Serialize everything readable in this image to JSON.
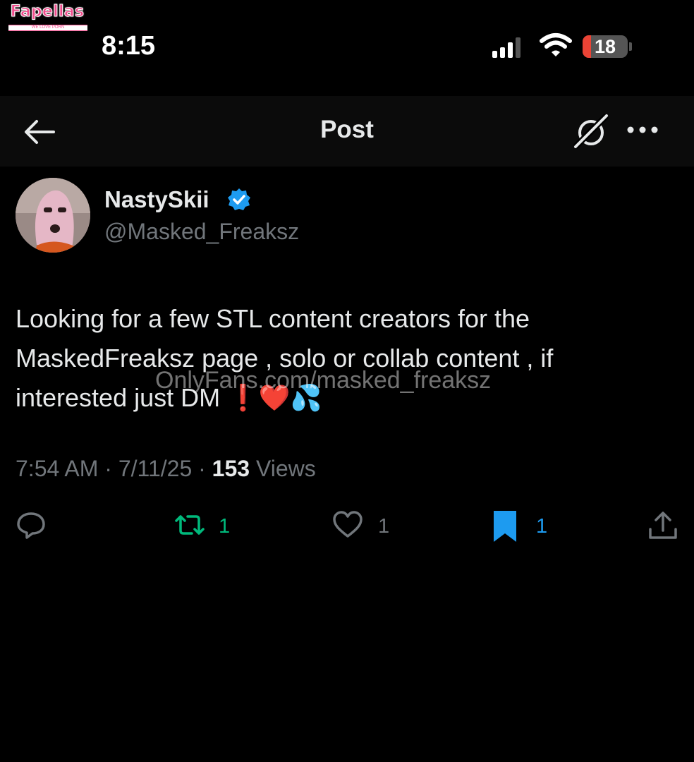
{
  "watermark": {
    "brand": "Fapellas",
    "tagline": "WE LOVE PORN",
    "overlay_text": "OnlyFans.com/masked_freaksz"
  },
  "status_bar": {
    "time": "8:15",
    "battery": "18",
    "battery_level_percent": 18,
    "icons": [
      "cellular-signal-icon",
      "wifi-icon",
      "battery-icon"
    ]
  },
  "nav": {
    "title": "Post",
    "icons": [
      "back-arrow-icon",
      "grok-icon",
      "more-icon"
    ]
  },
  "post": {
    "display_name": "NastySkii",
    "handle": "@Masked_Freaksz",
    "text": "Looking for a few STL content creators for the MaskedFreaksz page , solo or collab content , if interested just DM ❗️❤️💦",
    "time": "7:54 AM",
    "date": "7/11/25",
    "views_count": "153",
    "views_label": "Views",
    "separator": "·"
  },
  "actions": {
    "reply": {
      "icon": "reply-icon"
    },
    "repost": {
      "icon": "repost-icon",
      "count": "1",
      "color": "#00ba7c"
    },
    "like": {
      "icon": "heart-icon",
      "count": "1"
    },
    "bookmark": {
      "icon": "bookmark-icon",
      "count": "1",
      "color": "#1d9bf0"
    },
    "share": {
      "icon": "share-icon"
    }
  },
  "colors": {
    "background": "#000000",
    "secondary_text": "#71767b",
    "verified": "#1d9bf0"
  }
}
